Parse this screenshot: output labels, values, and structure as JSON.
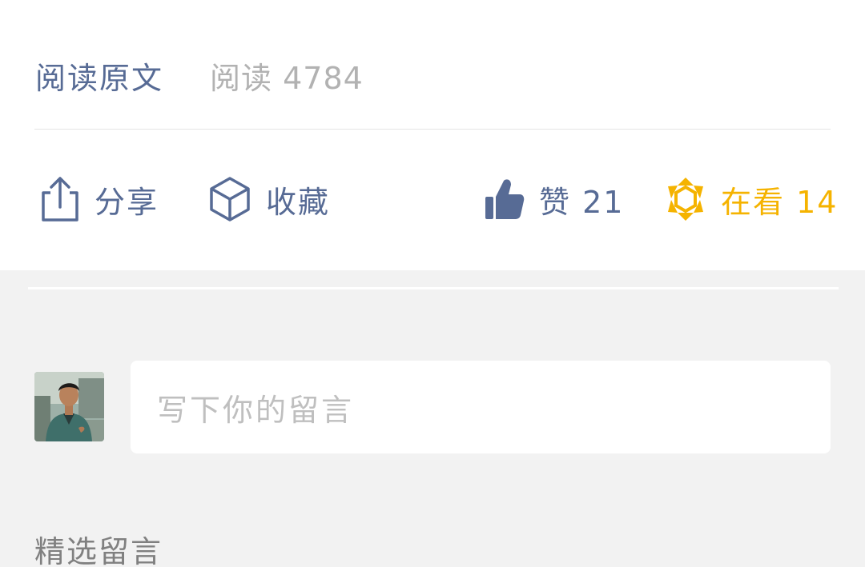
{
  "article_footer": {
    "read_original_label": "阅读原文",
    "read_count_text": "阅读 4784"
  },
  "actions": {
    "share": {
      "label": "分享",
      "icon": "share-icon"
    },
    "favorite": {
      "label": "收藏",
      "icon": "cube-icon"
    },
    "like": {
      "label": "赞 21",
      "icon": "thumbs-up-icon"
    },
    "looking": {
      "label": "在看 14",
      "icon": "star-burst-icon"
    }
  },
  "comments": {
    "input_placeholder": "写下你的留言",
    "featured_heading": "精选留言",
    "avatar": "user-avatar-photo"
  },
  "colors": {
    "link_blue": "#576b95",
    "looking_yellow": "#f5b300",
    "muted_gray": "#b2b2b2",
    "section_bg": "#f2f2f2"
  }
}
